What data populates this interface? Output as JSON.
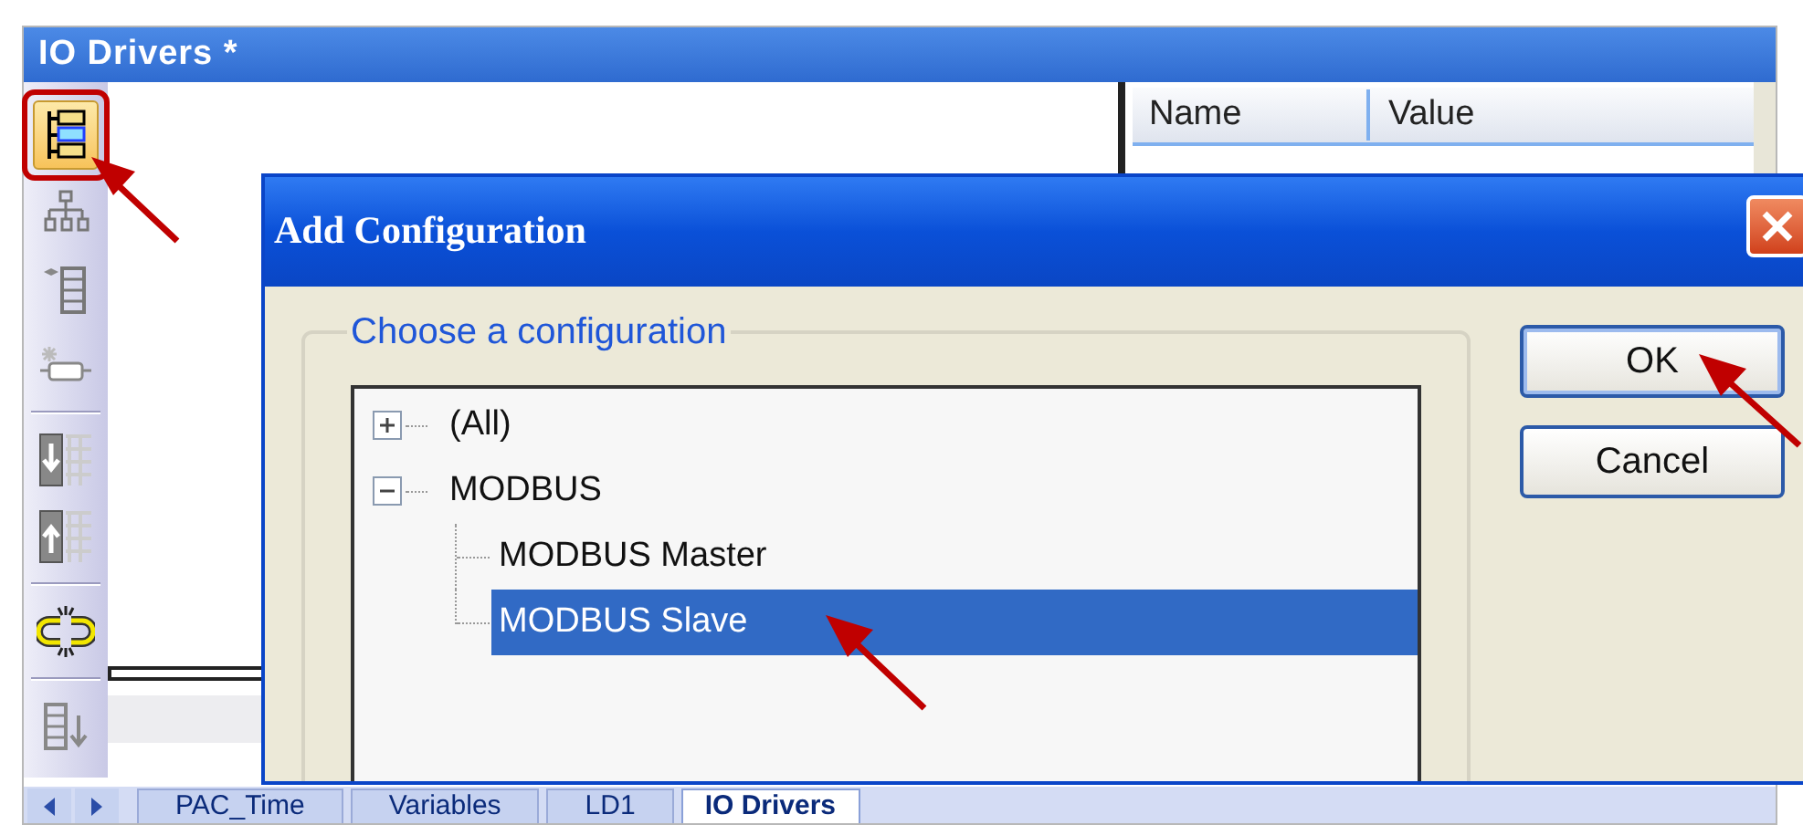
{
  "window": {
    "title": "IO Drivers *"
  },
  "toolbar": [
    {
      "kind": "tree",
      "highlighted": true
    },
    {
      "kind": "network",
      "highlighted": false
    },
    {
      "kind": "list",
      "highlighted": false
    },
    {
      "kind": "device",
      "highlighted": false
    },
    {
      "kind": "separator"
    },
    {
      "kind": "import",
      "highlighted": false
    },
    {
      "kind": "export",
      "highlighted": false
    },
    {
      "kind": "separator"
    },
    {
      "kind": "link",
      "highlighted": false
    },
    {
      "kind": "separator"
    },
    {
      "kind": "sort",
      "highlighted": false
    }
  ],
  "properties": {
    "columns": [
      "Name",
      "Value"
    ]
  },
  "dialog": {
    "title": "Add Configuration",
    "group_label": "Choose a configuration",
    "tree": [
      {
        "label": "(All)",
        "expanded": false,
        "selected": false
      },
      {
        "label": "MODBUS",
        "expanded": true,
        "selected": false,
        "children": [
          {
            "label": "MODBUS Master",
            "selected": false
          },
          {
            "label": "MODBUS Slave",
            "selected": true
          }
        ]
      }
    ],
    "buttons": [
      {
        "label": "OK",
        "default": true
      },
      {
        "label": "Cancel",
        "default": false
      }
    ]
  },
  "tabs": [
    {
      "label": "PAC_Time",
      "selected": false
    },
    {
      "label": "Variables",
      "selected": false
    },
    {
      "label": "LD1",
      "selected": false
    },
    {
      "label": "IO Drivers",
      "selected": true
    }
  ]
}
